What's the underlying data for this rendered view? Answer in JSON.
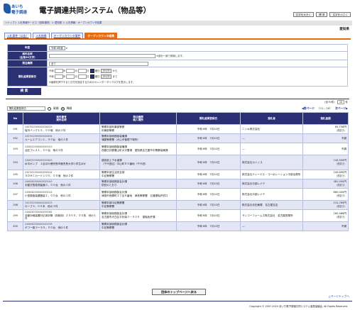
{
  "header": {
    "logo_line1": "あいち",
    "logo_line2": "電子調達",
    "title": "電子調達共同システム（物品等）",
    "font_buttons": [
      "文字を大きく",
      "標 準",
      "文字を小さく"
    ]
  },
  "breadcrumb": "＞トップ＞ 入札情報サービス（団体選択）＞ 愛知県 ＞ 入札情報：オープンカウンタ結果",
  "org": "愛知県",
  "tabs": [
    "入札案件（公告）",
    "入札結果",
    "オープンカウンタ案件",
    "オープンカウンタ結果"
  ],
  "form": {
    "year_label": "年度",
    "year_value": "令和 6年度",
    "name_label": "案件名称\n（全角50文字）",
    "name_note": "※部分一致で検索します。",
    "type_label": "発注機関",
    "type_value": "全て",
    "date_label": "開札結果登録日",
    "from_era": "令和",
    "to_era": "令和",
    "y": "年",
    "m": "月",
    "d": "日",
    "kara": "から",
    "made": "まで",
    "clear": "クリア",
    "yobi": "曜日",
    "note": "※画像を押下すると日付を指定するためのカレンダーダイアログを表示します。",
    "search": "検 索"
  },
  "pager": {
    "count": "（全70件）",
    "per_page": "10",
    "unit": "件"
  },
  "sort": {
    "select": "開札結果登録日",
    "asc": "昇順",
    "desc": "降順",
    "prev": "前ページ",
    "range": "（11 - 20）",
    "next": "次ページ"
  },
  "columns": [
    "No",
    "案件番号\n案件名称",
    "発注機関\n納入場所",
    "開札結果登録日",
    "落札者",
    "落札金額"
  ],
  "rows": [
    {
      "no": "191",
      "id": "2407052300000026525",
      "name": "保冷バッグ１５，００個　他の２件",
      "org": "警察本部刑事部警察",
      "place": "刑事部警察",
      "date": "令和 6年　7月10日",
      "winner": "ニシキ株式会社",
      "amt": "65,758円",
      "tax": "（税抜き）",
      "alt": false
    },
    {
      "no": "192",
      "id": "2407042300000026494",
      "name": "ルームエアコン１，００台　他の１件",
      "org": "警察本部総務部装備課",
      "place": "蒲郡警察署（犬山市管理下場所）",
      "date": "令和 6年　7月10日",
      "winner": "―",
      "amt": "不調",
      "tax": "",
      "alt": true
    },
    {
      "no": "193",
      "id": "2406252300000025913",
      "name": "油圧プレス１，００台　他の２件",
      "org": "警察本部総務部装備課",
      "place": "西春日井郡豊山町大字豊場　愛知県名古屋市中警察装備課",
      "date": "令和 6年　7月10日",
      "winner": "―",
      "amt": "不調",
      "tax": "",
      "alt": false
    },
    {
      "no": "194",
      "id": "2406252300000025843",
      "name": "水中ポンプ　１台ほか鹿児島市鹿児島大学小学生ほか",
      "org": "建設部上下水道課",
      "place": "（千代田区）中山町８０番地（千代田）",
      "date": "令和 6年　7月10日",
      "winner": "株式会社カイノス",
      "amt": "143,500円",
      "tax": "（税抜き）",
      "alt": true
    },
    {
      "no": "195",
      "id": "2407052300000026544",
      "name": "ＳＤＨＣカード１００，００個　他の２件",
      "org": "警察本部生活安全部",
      "place": "中区警察署",
      "date": "令和 6年　7月10日",
      "winner": "株式会社ティーエス・コーポレーション中部出張所",
      "amt": "249,890円",
      "tax": "（税抜き）",
      "alt": false
    },
    {
      "no": "196",
      "id": "2406282300000025043",
      "name": "手動式簡易測量器３，００台　他の１件",
      "org": "警察本部総務部会計課",
      "place": "防犯のとおり",
      "date": "令和 6年　7月10日",
      "winner": "株式会社中部レナテ",
      "amt": "381,000円",
      "tax": "（税抜き）",
      "alt": true
    },
    {
      "no": "197",
      "id": "2406282300000025014",
      "name": "小型調査装置器量１，００台　他の１件",
      "org": "警察本部総務部会計課",
      "place": "津島市西郷町２丁目８番地　津島警察署　交通課免許窓口",
      "date": "令和 6年　7月10日",
      "winner": "株式会社中部レナテ",
      "amt": "660,000円",
      "tax": "（税抜き）",
      "alt": false
    },
    {
      "no": "198",
      "id": "2407052300000026523",
      "name": "ロープ３，００本　他の３件",
      "org": "警察本部中区警察署",
      "place": "中区警察署",
      "date": "令和 6年　7月10日",
      "winner": "株式会社寺田東電　名古屋支店",
      "amt": "212,765円",
      "tax": "（税抜き）",
      "alt": true
    },
    {
      "no": "199",
      "id": "2406262300000025062",
      "name": "自動封緘装置対応用封筒（用紙用）２０００，００枚　他の１件",
      "org": "警察本部総務部会計課",
      "place": "名古屋市天白区平針南３－５０５　運転免許課",
      "date": "令和 6年　7月10日",
      "winner": "サンコーフォームズ株式会社　名古屋営業所",
      "amt": "165,486円",
      "tax": "（税抜き）",
      "alt": false
    },
    {
      "no": "200",
      "id": "2406282300000025035",
      "name": "ギフー取ラーラ５，００台　他の１件",
      "org": "警察本部総務部会計課",
      "place": "中区警察署",
      "date": "令和 6年　7月10日",
      "winner": "―",
      "amt": "不調",
      "tax": "",
      "alt": true
    }
  ],
  "back_button": "団体のトップページへ戻る",
  "page_top": "△ページトップへ",
  "copyright": "Copyright © 2007-2024 あいち電子調達共同システム運営協議会, All Rights Reserved."
}
